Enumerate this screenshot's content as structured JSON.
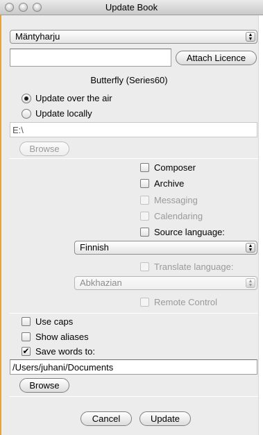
{
  "window": {
    "title": "Update Book"
  },
  "phone_popup": {
    "value": "Mäntyharju",
    "stepper_icon": "up-down-arrows-icon"
  },
  "licence": {
    "value": "",
    "attach_label": "Attach Licence"
  },
  "device_label": "Butterfly (Series60)",
  "update_mode": {
    "options": [
      {
        "label": "Update over the air",
        "selected": true
      },
      {
        "label": "Update locally",
        "selected": false
      }
    ]
  },
  "local_path": {
    "value": "E:\\",
    "browse_label": "Browse",
    "browse_enabled": false
  },
  "options": {
    "composer": {
      "label": "Composer",
      "checked": false,
      "enabled": true
    },
    "archive": {
      "label": "Archive",
      "checked": false,
      "enabled": true
    },
    "messaging": {
      "label": "Messaging",
      "checked": false,
      "enabled": false
    },
    "calendaring": {
      "label": "Calendaring",
      "checked": false,
      "enabled": false
    },
    "source_language": {
      "label": "Source language:",
      "checked": false,
      "enabled": true
    }
  },
  "source_language_popup": {
    "value": "Finnish",
    "enabled": true
  },
  "translate_language": {
    "label": "Translate language:",
    "checked": false,
    "enabled": false
  },
  "translate_language_popup": {
    "value": "Abkhazian",
    "enabled": false
  },
  "remote_control": {
    "label": "Remote Control",
    "checked": false,
    "enabled": false
  },
  "extras": {
    "use_caps": {
      "label": "Use caps",
      "checked": false
    },
    "show_aliases": {
      "label": "Show aliases",
      "checked": false
    },
    "save_words": {
      "label": "Save words to:",
      "checked": true
    }
  },
  "save_path": {
    "value": "/Users/juhani/Documents",
    "browse_label": "Browse"
  },
  "footer": {
    "cancel_label": "Cancel",
    "update_label": "Update"
  },
  "colors": {
    "accent_edge": "#e8a43c",
    "check_mark": "✔"
  }
}
